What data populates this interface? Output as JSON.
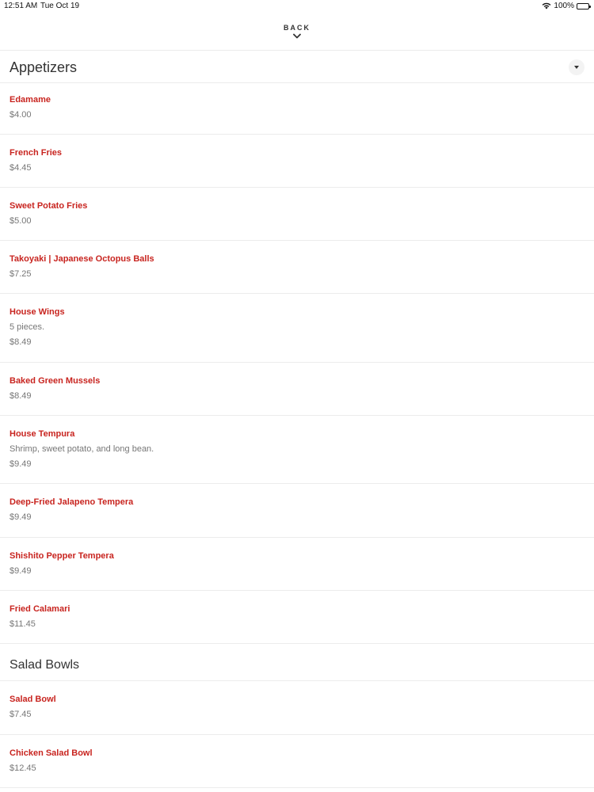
{
  "status_bar": {
    "time": "12:51 AM",
    "date": "Tue Oct 19",
    "battery": "100%"
  },
  "nav": {
    "back_label": "BACK"
  },
  "sections": {
    "appetizers": {
      "title": "Appetizers",
      "items": [
        {
          "name": "Edamame",
          "price": "$4.00"
        },
        {
          "name": "French Fries",
          "price": "$4.45"
        },
        {
          "name": "Sweet Potato Fries",
          "price": "$5.00"
        },
        {
          "name": "Takoyaki | Japanese Octopus Balls",
          "price": "$7.25"
        },
        {
          "name": "House Wings",
          "desc": "5 pieces.",
          "price": "$8.49"
        },
        {
          "name": "Baked Green Mussels",
          "price": "$8.49"
        },
        {
          "name": "House Tempura",
          "desc": "Shrimp, sweet potato, and long bean.",
          "price": "$9.49"
        },
        {
          "name": "Deep-Fried Jalapeno Tempera",
          "price": "$9.49"
        },
        {
          "name": "Shishito Pepper Tempera",
          "price": "$9.49"
        },
        {
          "name": "Fried Calamari",
          "price": "$11.45"
        }
      ]
    },
    "salad_bowls": {
      "title": "Salad Bowls",
      "items": [
        {
          "name": "Salad Bowl",
          "price": "$7.45"
        },
        {
          "name": "Chicken Salad Bowl",
          "price": "$12.45"
        }
      ]
    }
  },
  "colors": {
    "item_name": "#c8241f",
    "secondary_text": "#777777",
    "divider": "#ececec"
  }
}
